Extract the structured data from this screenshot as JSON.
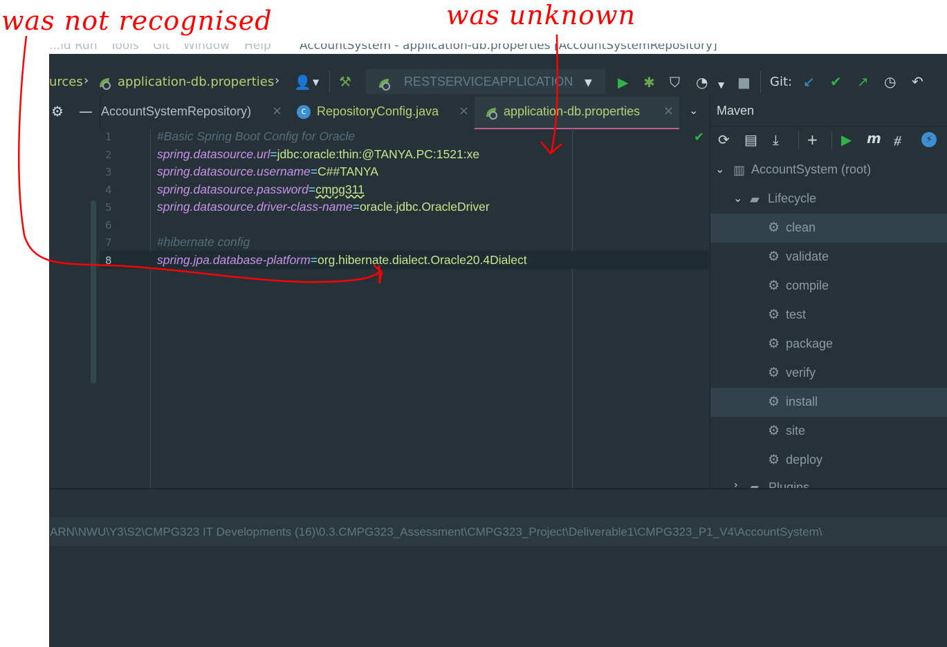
{
  "annotations": {
    "left": "was not recognised",
    "right": "was unknown"
  },
  "menu": [
    "...ld",
    "Run",
    "Tools",
    "Git",
    "Window",
    "Help",
    "AccountSystem - application-db.properties [AccountSystemRepository]"
  ],
  "toolbar": {
    "breadcrumb_prefix": "urces",
    "breadcrumb_file": "application-db.properties",
    "run_config": "RESTSERVICEAPPLICATION",
    "git_label": "Git:"
  },
  "tabs": {
    "tab1": "AccountSystemRepository)",
    "tab2": "RepositoryConfig.java",
    "tab3": "application-db.properties"
  },
  "editor": {
    "lines": [
      {
        "num": "1",
        "comment": "#Basic Spring Boot Config for Oracle"
      },
      {
        "num": "2",
        "key": "spring.datasource.url",
        "eq": "=",
        "value": "jdbc:oracle:thin:@TANYA.PC:1521:xe"
      },
      {
        "num": "3",
        "key": "spring.datasource.username",
        "eq": "=",
        "value": "C##TANYA"
      },
      {
        "num": "4",
        "key": "spring.datasource.password",
        "eq": "=",
        "value": "cmpg311"
      },
      {
        "num": "5",
        "key": "spring.datasource.driver-class-name",
        "eq": "=",
        "value": "oracle.jdbc.OracleDriver"
      },
      {
        "num": "6"
      },
      {
        "num": "7",
        "comment": "#hibernate config"
      },
      {
        "num": "8",
        "key": "spring.jpa.database-platform",
        "eq": "=",
        "value": "org.hibernate.dialect.Oracle20.4Dialect"
      }
    ]
  },
  "maven": {
    "title": "Maven",
    "root": "AccountSystem (root)",
    "lifecycle": "Lifecycle",
    "goals": [
      "clean",
      "validate",
      "compile",
      "test",
      "package",
      "verify",
      "install",
      "site",
      "deploy"
    ],
    "plugins": "Plugins"
  },
  "status": {
    "path": "ARN\\NWU\\Y3\\S2\\CMPG323 IT Developments (16)\\0.3.CMPG323_Assessment\\CMPG323_Project\\Deliverable1\\CMPG323_P1_V4\\AccountSystem\\"
  },
  "colors": {
    "background": "#263238",
    "key": "#c792ea",
    "value": "#c3e88d",
    "annotation": "#ff0000"
  }
}
